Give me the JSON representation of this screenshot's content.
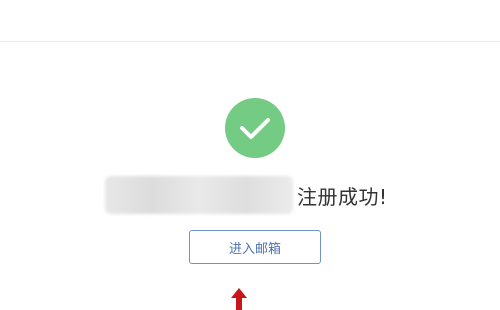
{
  "status": {
    "icon": "checkmark-icon",
    "icon_color": "#74cb83",
    "message": "注册成功!"
  },
  "actions": {
    "go_to_mailbox_label": "进入邮箱"
  },
  "annotation": {
    "icon": "red-up-arrow-icon",
    "color": "#c8161d"
  },
  "colors": {
    "button_border": "#6f93c8",
    "button_text": "#4c73b0",
    "divider": "#ececec"
  }
}
